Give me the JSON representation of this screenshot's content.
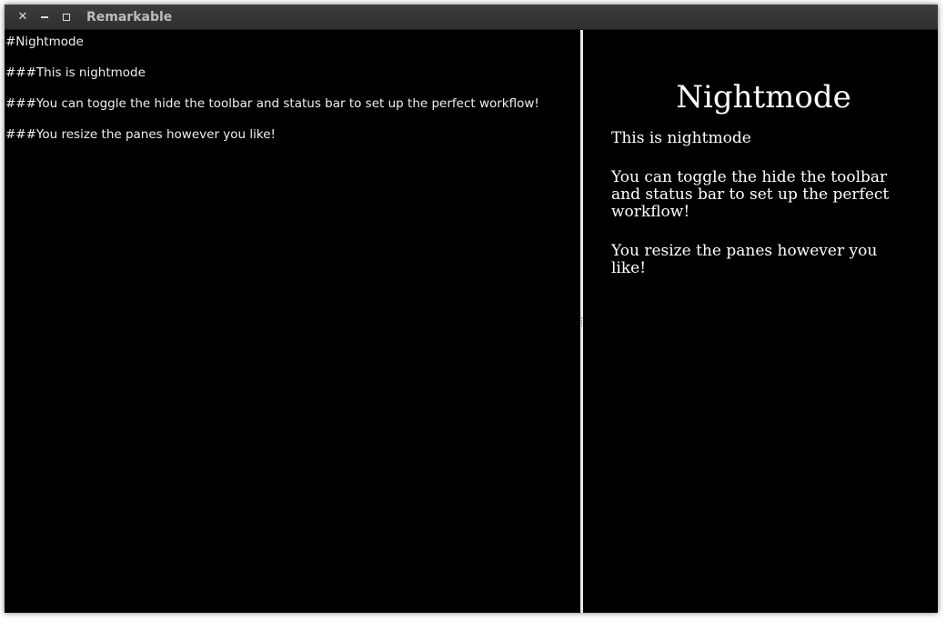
{
  "window": {
    "title": "Remarkable",
    "buttons": {
      "close_icon": "close-icon",
      "minimize_icon": "minimize-icon",
      "maximize_icon": "maximize-icon"
    }
  },
  "editor": {
    "lines": [
      "#Nightmode",
      "###This is nightmode",
      "###You can toggle the hide the toolbar and status bar to set up the perfect workflow!",
      "###You resize the panes however you like!"
    ]
  },
  "preview": {
    "heading": "Nightmode",
    "paragraphs": [
      "This is nightmode",
      "You can toggle the hide the toolbar and status bar to set up the perfect workflow!",
      "You resize the panes however you like!"
    ]
  },
  "colors": {
    "background": "#000000",
    "text": "#ffffff",
    "titlebar": "#343434",
    "splitter": "#e6e6e6"
  }
}
